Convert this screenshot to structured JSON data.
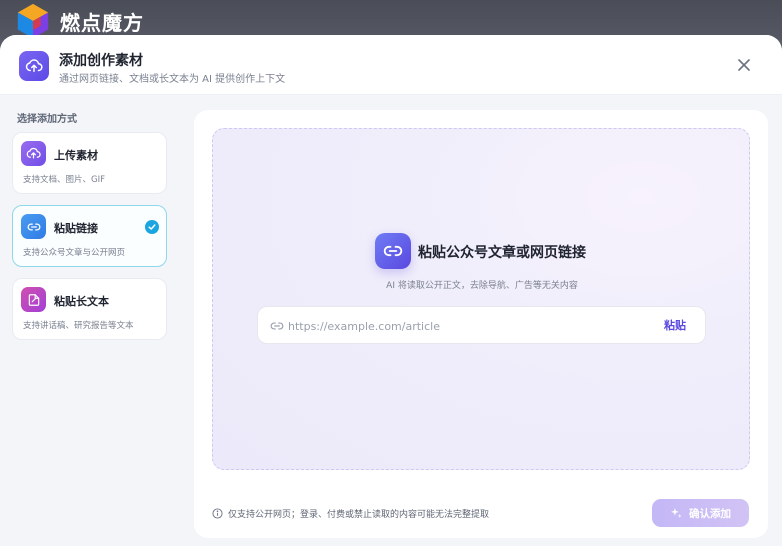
{
  "brand": {
    "name": "燃点魔方",
    "icon": "cube-logo-icon"
  },
  "header": {
    "title": "添加创作素材",
    "subtitle": "通过网页链接、文档或长文本为 AI 提供创作上下文",
    "icon": "cloud-upload-icon",
    "close_icon": "close-icon"
  },
  "sidebar": {
    "heading": "选择添加方式",
    "items": [
      {
        "title": "上传素材",
        "desc": "支持文档、图片、GIF",
        "icon": "cloud-upload-icon",
        "selected": false
      },
      {
        "title": "粘贴链接",
        "desc": "支持公众号文章与公开网页",
        "icon": "link-icon",
        "selected": true
      },
      {
        "title": "粘贴长文本",
        "desc": "支持讲话稿、研究报告等文本",
        "icon": "document-edit-icon",
        "selected": false
      }
    ]
  },
  "main": {
    "title": "粘贴公众号文章或网页链接",
    "subtitle": "AI 将读取公开正文，去除导航、广告等无关内容",
    "input": {
      "placeholder": "https://example.com/article",
      "value": ""
    },
    "paste_label": "粘贴",
    "footer_note": "仅支持公开网页；登录、付费或禁止读取的内容可能无法完整提取",
    "confirm_label": "确认添加"
  },
  "colors": {
    "accent": "#5a48e0",
    "selected_border": "#8fd7ea",
    "check": "#1aa5e0",
    "confirm_disabled": "#c9bdf5"
  }
}
